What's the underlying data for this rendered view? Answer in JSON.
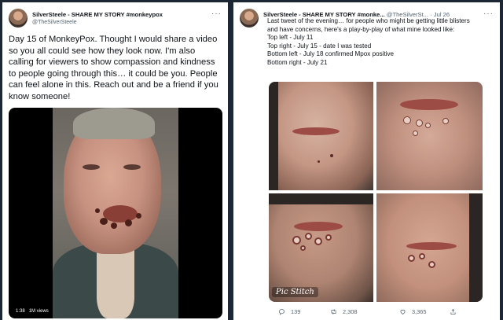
{
  "left_tweet": {
    "display_name": "SilverSteele - SHARE MY STORY #monkeypox",
    "handle": "@TheSilverSteele",
    "more": "···",
    "text": "Day 15 of MonkeyPox. Thought I would share a video so you all could see how they look now. I'm also calling for viewers to show compassion and kindness to people going through this… it could be you. People can feel alone in this. Reach out and be a friend if you know someone!",
    "video": {
      "time": "1:38",
      "views": "1M views"
    }
  },
  "right_tweet": {
    "display_name": "SilverSteele - SHARE MY STORY #monke...",
    "handle": "@TheSilverSt...",
    "date": "· Jul 26",
    "more": "···",
    "lines": [
      "Last tweet of the evening… for people who might be getting little blisters",
      "and have concerns, here's a play-by-play of what mine looked like:",
      "Top left - July 11",
      "Top right - July 15 - date I was tested",
      "Bottom left - July 18 confirmed Mpox positive",
      "Bottom right - July 21"
    ],
    "watermark": "Pic Stitch",
    "actions": {
      "replies": "139",
      "retweets": "2,308",
      "likes": "3,365"
    }
  },
  "icons": [
    "more-icon",
    "reply-icon",
    "retweet-icon",
    "like-icon",
    "share-icon"
  ]
}
